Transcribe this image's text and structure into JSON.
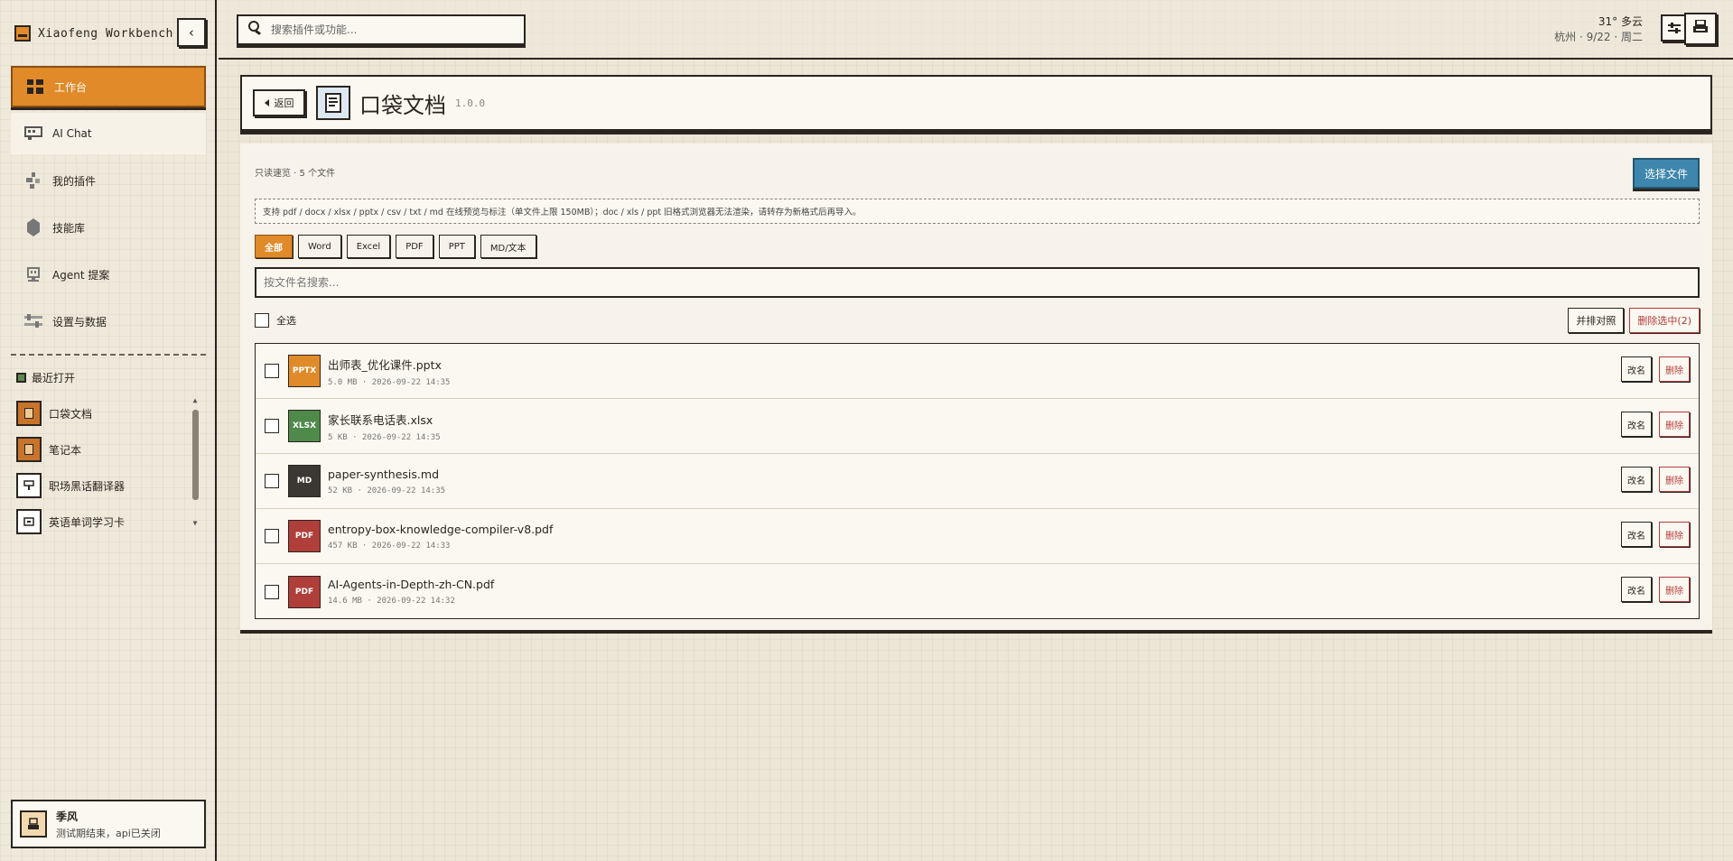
{
  "app": {
    "title": "Xiaofeng Workbench",
    "collapse_glyph": "‹"
  },
  "sidebar": {
    "nav": [
      {
        "label": "工作台",
        "icon": "dashboard-icon",
        "active": true
      },
      {
        "label": "AI Chat",
        "icon": "chat-icon"
      },
      {
        "label": "我的插件",
        "icon": "plugin-icon"
      },
      {
        "label": "技能库",
        "icon": "skills-icon"
      },
      {
        "label": "Agent 提案",
        "icon": "agent-icon"
      },
      {
        "label": "设置与数据",
        "icon": "settings-icon"
      }
    ],
    "recent_title": "最近打开",
    "recent": [
      {
        "label": "口袋文档",
        "icon": "document-icon"
      },
      {
        "label": "笔记本",
        "icon": "notebook-icon"
      },
      {
        "label": "职场黑话翻译器",
        "icon": "translator-icon"
      },
      {
        "label": "英语单词学习卡",
        "icon": "flashcard-icon"
      }
    ],
    "user": {
      "name": "季风",
      "status": "测试期结束，api已关闭"
    }
  },
  "topbar": {
    "search_placeholder": "搜索插件或功能...",
    "weather": {
      "line1": "31° 多云",
      "line2": "杭州 · 9/22 · 周二"
    }
  },
  "page": {
    "back_label": "返回",
    "title": "口袋文档",
    "version": "1.0.0",
    "meta": "只读速览 · 5 个文件",
    "choose_label": "选择文件",
    "notice": "支持 pdf / docx / xlsx / pptx / csv / txt / md 在线预览与标注（单文件上限 150MB）；doc / xls / ppt 旧格式浏览器无法渲染，请转存为新格式后再导入。",
    "filters": [
      "全部",
      "Word",
      "Excel",
      "PDF",
      "PPT",
      "MD/文本"
    ],
    "active_filter": 0,
    "file_search_placeholder": "按文件名搜索...",
    "select_all_label": "全选",
    "merge_label": "并排对照",
    "delete_selected_label": "删除选中(2)",
    "rename_label": "改名",
    "delete_label": "删除",
    "files": [
      {
        "name": "出师表_优化课件.pptx",
        "meta": "5.0 MB · 2026-09-22 14:35",
        "type": "PPTX",
        "color": "#e08a2a"
      },
      {
        "name": "家长联系电话表.xlsx",
        "meta": "5 KB · 2026-09-22 14:35",
        "type": "XLSX",
        "color": "#4f8a4a"
      },
      {
        "name": "paper-synthesis.md",
        "meta": "52 KB · 2026-09-22 14:35",
        "type": "MD",
        "color": "#3b3833"
      },
      {
        "name": "entropy-box-knowledge-compiler-v8.pdf",
        "meta": "457 KB · 2026-09-22 14:33",
        "type": "PDF",
        "color": "#b03e3a"
      },
      {
        "name": "AI-Agents-in-Depth-zh-CN.pdf",
        "meta": "14.6 MB · 2026-09-22 14:32",
        "type": "PDF",
        "color": "#b03e3a"
      }
    ]
  },
  "colors": {
    "accent": "#e08a2a",
    "primary": "#3e86ad",
    "danger": "#b43c3c",
    "ink": "#2b2520"
  }
}
